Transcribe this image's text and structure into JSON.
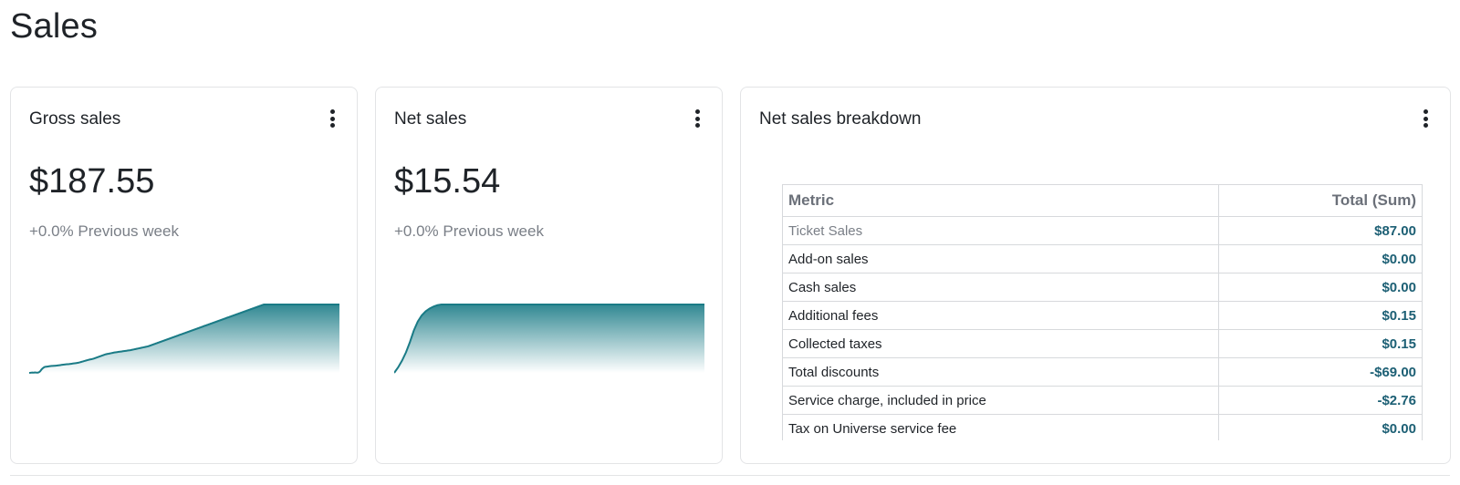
{
  "page": {
    "title": "Sales"
  },
  "gross_sales": {
    "title": "Gross sales",
    "value": "$187.55",
    "change": "+0.0% Previous week",
    "chart_data": {
      "type": "area",
      "values": [
        0.0,
        0.1,
        0.25,
        0.5,
        0.3,
        0.4,
        0.7,
        0.5,
        0.4,
        0.3,
        0.7,
        1.5,
        3.0,
        5.0,
        6.3,
        7.5,
        8.5,
        8.8,
        9.0,
        9.2,
        9.4,
        9.6,
        9.8,
        10.0,
        10.1,
        10.2,
        10.3,
        10.4,
        10.5,
        10.6,
        10.8,
        11.0,
        11.2,
        11.4,
        11.6,
        11.8,
        12.0,
        12.2,
        12.4,
        12.5,
        12.6,
        12.7,
        12.8,
        13.0,
        13.2,
        13.4,
        13.6,
        13.8,
        14.0,
        14.2,
        14.4,
        14.6,
        14.8,
        15.2,
        15.6,
        16.0,
        16.4,
        16.8,
        17.2,
        17.6,
        18.0,
        18.4,
        18.8,
        19.2,
        19.5,
        19.8,
        20.0,
        20.4,
        20.8,
        21.3,
        21.8,
        22.3,
        22.8,
        23.3,
        23.8,
        24.3,
        24.8,
        25.3,
        25.8,
        26.3,
        26.8,
        27.2,
        27.5,
        27.8,
        28.0,
        28.3,
        28.6,
        28.9,
        29.2,
        29.5,
        29.8,
        30.0,
        30.2,
        30.4,
        30.6,
        30.8,
        31.0,
        31.2,
        31.4,
        31.6,
        31.8,
        32.0,
        32.2,
        32.4,
        32.6,
        32.8,
        33.0,
        33.2,
        33.5,
        33.8,
        34.1,
        34.4,
        34.7,
        35.0,
        35.3,
        35.6,
        35.9,
        36.2,
        36.5,
        36.8,
        37.1,
        37.4,
        37.7,
        38.0,
        38.3,
        38.6,
        39.0,
        39.5,
        40.0,
        40.5,
        41.0,
        41.5,
        42.0,
        42.5,
        43.0,
        43.5,
        44.0,
        44.5,
        45.0,
        45.5,
        46.0,
        46.5,
        47.0,
        47.5,
        48.0,
        48.5,
        49.0,
        49.5,
        50.0,
        50.5,
        51.0,
        51.5,
        52.0,
        52.5,
        53.0,
        53.5,
        54.0,
        54.5,
        55.0,
        55.5,
        56.0,
        56.5,
        57.0,
        57.5,
        58.0,
        58.5,
        59.0,
        59.5,
        60.0,
        60.5,
        61.0,
        61.5,
        62.0,
        62.5,
        63.0,
        63.5,
        64.0,
        64.5,
        65.0,
        65.5,
        66.0,
        66.5,
        67.0,
        67.5,
        68.0,
        68.5,
        69.0,
        69.5,
        70.0,
        70.5,
        71.0,
        71.5,
        72.0,
        72.5,
        73.0,
        73.5,
        74.0,
        74.5,
        75.0,
        75.5,
        76.0,
        76.5,
        77.0,
        77.5,
        78.0,
        78.5,
        79.0,
        79.5,
        80.0,
        80.5,
        81.0,
        81.5,
        82.0,
        82.5,
        83.0,
        83.5,
        84.0,
        84.5,
        85.0,
        85.5,
        86.0,
        86.5,
        87.0,
        87.5,
        88.0,
        88.5,
        89.0,
        89.5,
        90.0,
        90.5,
        91.0,
        91.5,
        92.0,
        92.5,
        93.0,
        93.5,
        94.0,
        94.5,
        95.0,
        95.5,
        96.0,
        96.5,
        97.0,
        97.5,
        98.0,
        98.5,
        99.0,
        99.5,
        100,
        100,
        100,
        100,
        100,
        100,
        100,
        100,
        100,
        100,
        100,
        100,
        100,
        100,
        100,
        100,
        100,
        100,
        100,
        100,
        100,
        100,
        100,
        100,
        100,
        100,
        100,
        100,
        100,
        100,
        100,
        100,
        100,
        100,
        100,
        100,
        100,
        100,
        100,
        100,
        100,
        100,
        100,
        100,
        100,
        100,
        100,
        100,
        100,
        100,
        100,
        100,
        100,
        100,
        100,
        100,
        100,
        100,
        100,
        100,
        100,
        100,
        100,
        100,
        100,
        100,
        100,
        100,
        100,
        100,
        100,
        100,
        100,
        100,
        100,
        100,
        100,
        100,
        100,
        100,
        100
      ],
      "ymax": 100,
      "color": "#1a7b86"
    }
  },
  "net_sales": {
    "title": "Net sales",
    "value": "$15.54",
    "change": "+0.0% Previous week",
    "chart_data": {
      "type": "area",
      "values": [
        0,
        8,
        18,
        30,
        45,
        62,
        75,
        84,
        90,
        94,
        97,
        99,
        100,
        100,
        100,
        100,
        100,
        100,
        100,
        100,
        100,
        100,
        100,
        100,
        100,
        100,
        100,
        100,
        100,
        100,
        100,
        100,
        100,
        100,
        100,
        100,
        100,
        100,
        100,
        100,
        100,
        100,
        100,
        100,
        100,
        100,
        100,
        100,
        100,
        100,
        100,
        100,
        100,
        100,
        100,
        100,
        100,
        100,
        100,
        100,
        100,
        100,
        100,
        100,
        100,
        100,
        100,
        100,
        100,
        100,
        100,
        100,
        100,
        100,
        100,
        100,
        100,
        100,
        100,
        100
      ],
      "ymax": 100,
      "color": "#1a7b86"
    }
  },
  "breakdown": {
    "title": "Net sales breakdown",
    "chart_data": {
      "type": "table",
      "columns": [
        "Metric",
        "Total (Sum)"
      ],
      "rows": [
        {
          "metric": "Ticket Sales",
          "total": "$87.00",
          "muted": true
        },
        {
          "metric": "Add-on sales",
          "total": "$0.00"
        },
        {
          "metric": "Cash sales",
          "total": "$0.00"
        },
        {
          "metric": "Additional fees",
          "total": "$0.15"
        },
        {
          "metric": "Collected taxes",
          "total": "$0.15"
        },
        {
          "metric": "Total discounts",
          "total": "-$69.00"
        },
        {
          "metric": "Service charge, included in price",
          "total": "-$2.76"
        },
        {
          "metric": "Tax on Universe service fee",
          "total": "$0.00"
        }
      ]
    }
  },
  "icons": {
    "menu": "kebab-menu-icon"
  }
}
